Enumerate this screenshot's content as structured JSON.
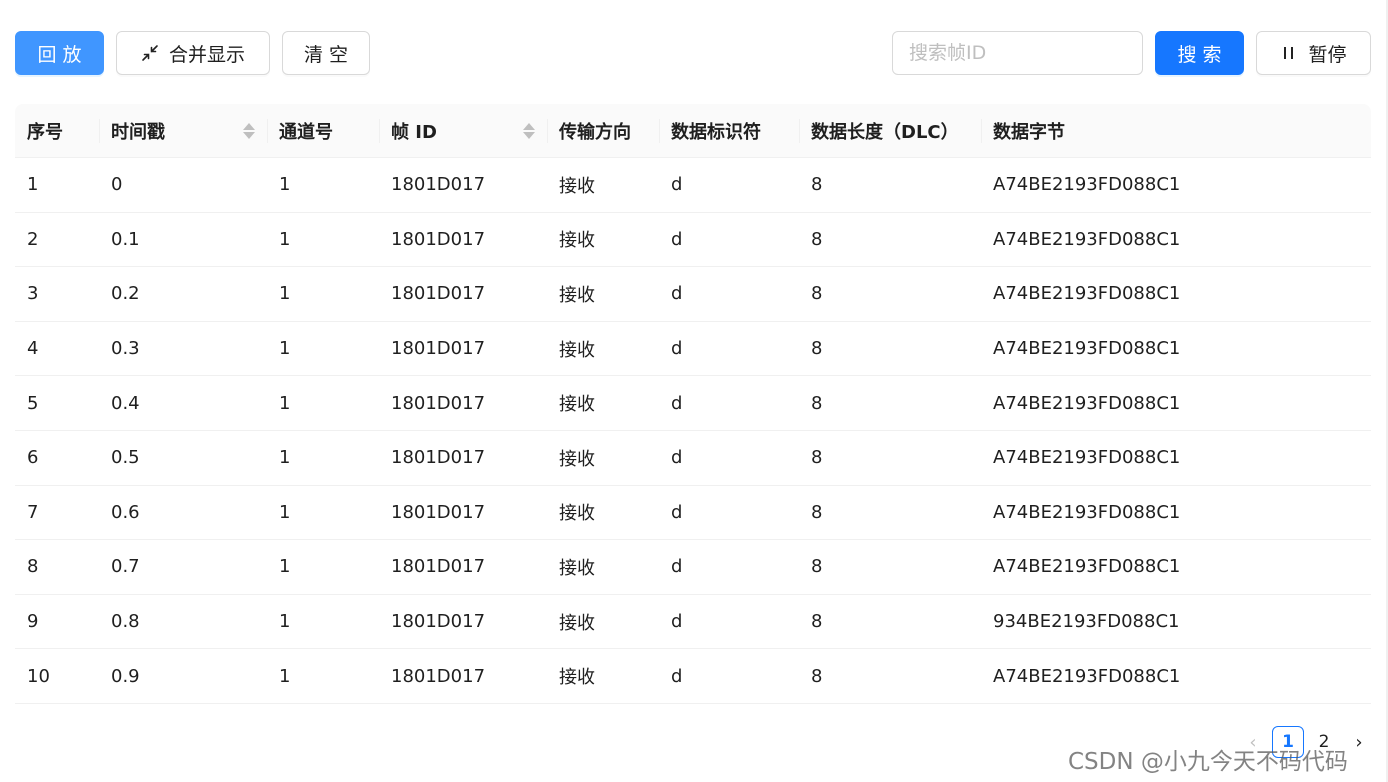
{
  "toolbar": {
    "playback_label": "回放",
    "merge_label": "合并显示",
    "clear_label": "清空",
    "search_placeholder": "搜索帧ID",
    "search_value": "",
    "search_button_label": "搜索",
    "pause_label": "暂停"
  },
  "colors": {
    "primary": "#1677ff",
    "primary_faded": "#4096ff",
    "border": "#d9d9d9",
    "header_bg": "#fafafa"
  },
  "table": {
    "columns": [
      "序号",
      "时间戳",
      "通道号",
      "帧 ID",
      "传输方向",
      "数据标识符",
      "数据长度（DLC）",
      "数据字节"
    ],
    "rows": [
      [
        "1",
        "0",
        "1",
        "1801D017",
        "接收",
        "d",
        "8",
        "A74BE2193FD088C1"
      ],
      [
        "2",
        "0.1",
        "1",
        "1801D017",
        "接收",
        "d",
        "8",
        "A74BE2193FD088C1"
      ],
      [
        "3",
        "0.2",
        "1",
        "1801D017",
        "接收",
        "d",
        "8",
        "A74BE2193FD088C1"
      ],
      [
        "4",
        "0.3",
        "1",
        "1801D017",
        "接收",
        "d",
        "8",
        "A74BE2193FD088C1"
      ],
      [
        "5",
        "0.4",
        "1",
        "1801D017",
        "接收",
        "d",
        "8",
        "A74BE2193FD088C1"
      ],
      [
        "6",
        "0.5",
        "1",
        "1801D017",
        "接收",
        "d",
        "8",
        "A74BE2193FD088C1"
      ],
      [
        "7",
        "0.6",
        "1",
        "1801D017",
        "接收",
        "d",
        "8",
        "A74BE2193FD088C1"
      ],
      [
        "8",
        "0.7",
        "1",
        "1801D017",
        "接收",
        "d",
        "8",
        "A74BE2193FD088C1"
      ],
      [
        "9",
        "0.8",
        "1",
        "1801D017",
        "接收",
        "d",
        "8",
        "934BE2193FD088C1"
      ],
      [
        "10",
        "0.9",
        "1",
        "1801D017",
        "接收",
        "d",
        "8",
        "A74BE2193FD088C1"
      ]
    ]
  },
  "pagination": {
    "pages": [
      "1",
      "2"
    ],
    "current": "1"
  },
  "watermark": "CSDN @小九今天不码代码"
}
